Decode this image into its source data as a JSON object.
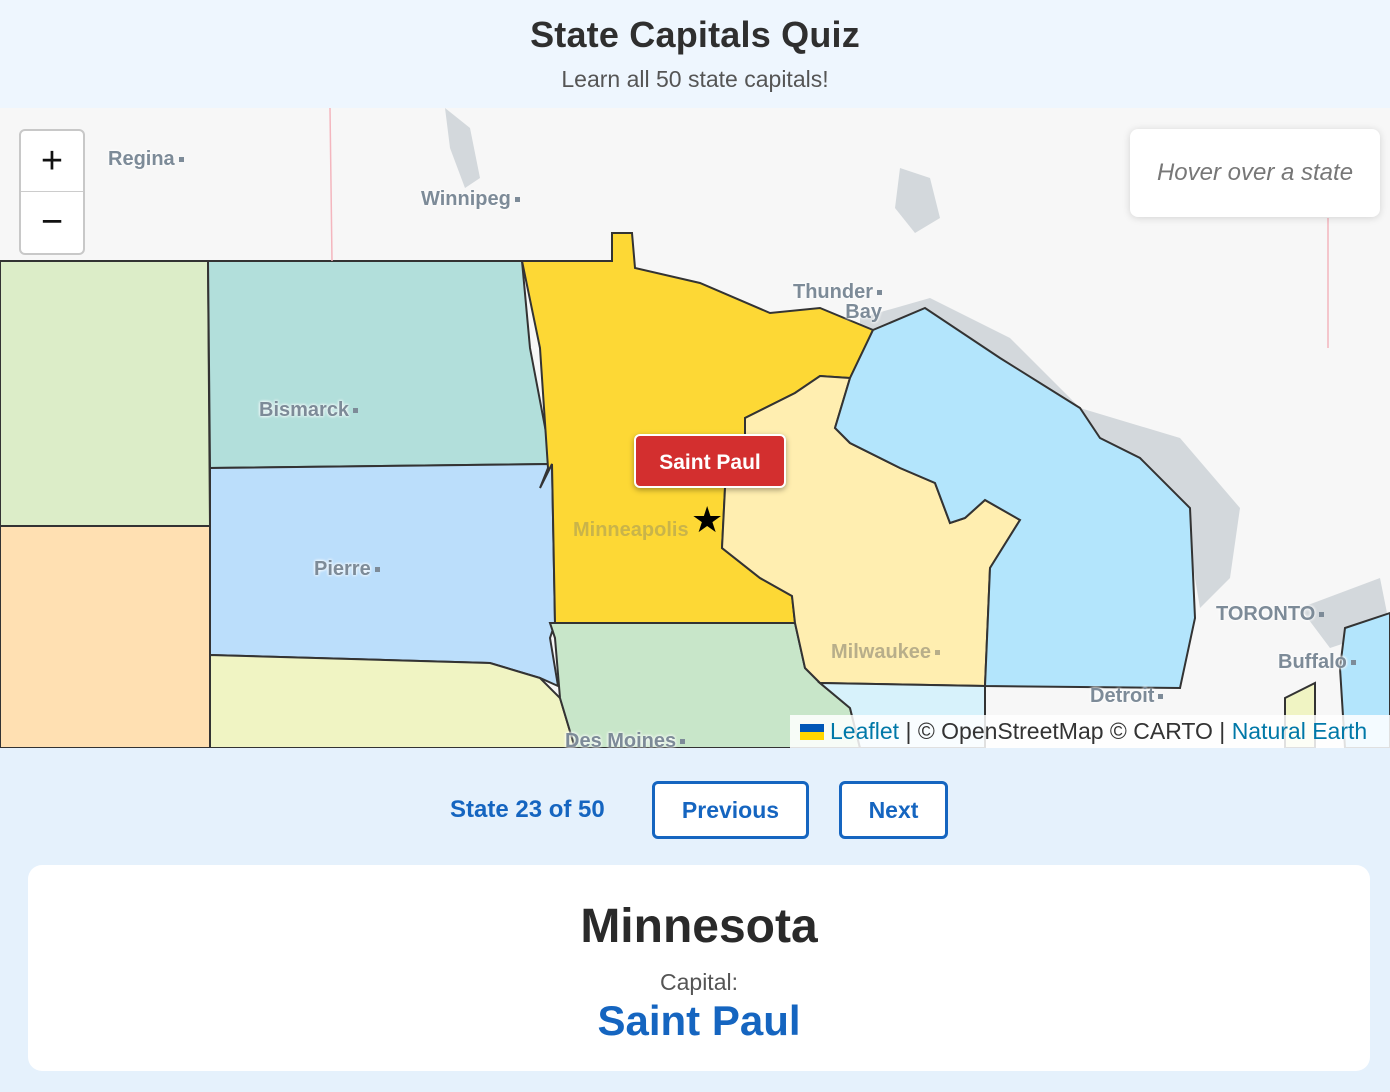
{
  "header": {
    "title": "State Capitals Quiz",
    "subtitle": "Learn all 50 state capitals!"
  },
  "map": {
    "zoom_in": "+",
    "zoom_out": "−",
    "hover_info": "Hover over a state",
    "capital_marker": "Saint Paul",
    "star_glyph": "★",
    "attribution": {
      "leaflet": "Leaflet",
      "sep1": " | © OpenStreetMap © CARTO | ",
      "natural_earth": "Natural Earth"
    },
    "cities": {
      "regina": "Regina",
      "winnipeg": "Winnipeg",
      "thunder_bay_1": "Thunder",
      "thunder_bay_2": "Bay",
      "bismarck": "Bismarck",
      "pierre": "Pierre",
      "minneapolis": "Minneapolis",
      "milwaukee": "Milwaukee",
      "toronto": "TORONTO",
      "buffalo": "Buffalo",
      "detroit": "Detroit",
      "des_moines": "Des Moines"
    },
    "colors": {
      "minnesota": "#fdd835",
      "north_dakota": "#b2dfdb",
      "south_dakota": "#bbdefb",
      "wisconsin": "#ffeeb0",
      "michigan": "#b3e5fc",
      "iowa": "#c8e6c9",
      "montana": "#dcedc8",
      "nebraska": "#f0f4c3",
      "wyoming": "#ffe0b2"
    }
  },
  "nav": {
    "counter": "State 23 of 50",
    "previous": "Previous",
    "next": "Next"
  },
  "card": {
    "state": "Minnesota",
    "capital_label": "Capital:",
    "capital": "Saint Paul"
  }
}
